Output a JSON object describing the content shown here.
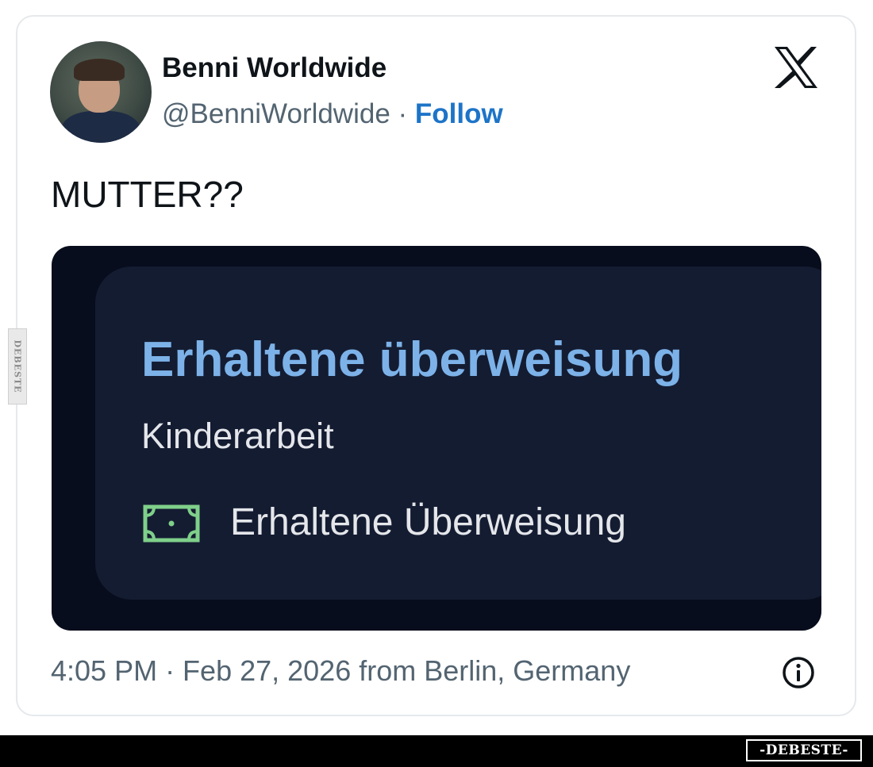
{
  "tweet": {
    "display_name": "Benni Worldwide",
    "handle": "@BenniWorldwide",
    "separator": " · ",
    "follow_label": "Follow",
    "text": "MUTTER??",
    "timestamp": "4:05 PM · Feb 27, 2026 from Berlin, Germany"
  },
  "media": {
    "notification_title": "Erhaltene überweisung",
    "notification_subtitle": "Kinderarbeit",
    "notification_detail": "Erhaltene Überweisung",
    "icon": "money-icon"
  },
  "icons": {
    "logo": "x-logo-icon",
    "info": "info-icon",
    "avatar": "avatar"
  },
  "watermarks": {
    "side": "DEBESTE",
    "bottom": "-DEBESTE-"
  },
  "colors": {
    "follow": "#1d74c8",
    "notification_title": "#7cb2e8",
    "money_icon": "#7fd08a",
    "media_background": "#070d1c",
    "notification_background": "#141c32"
  }
}
